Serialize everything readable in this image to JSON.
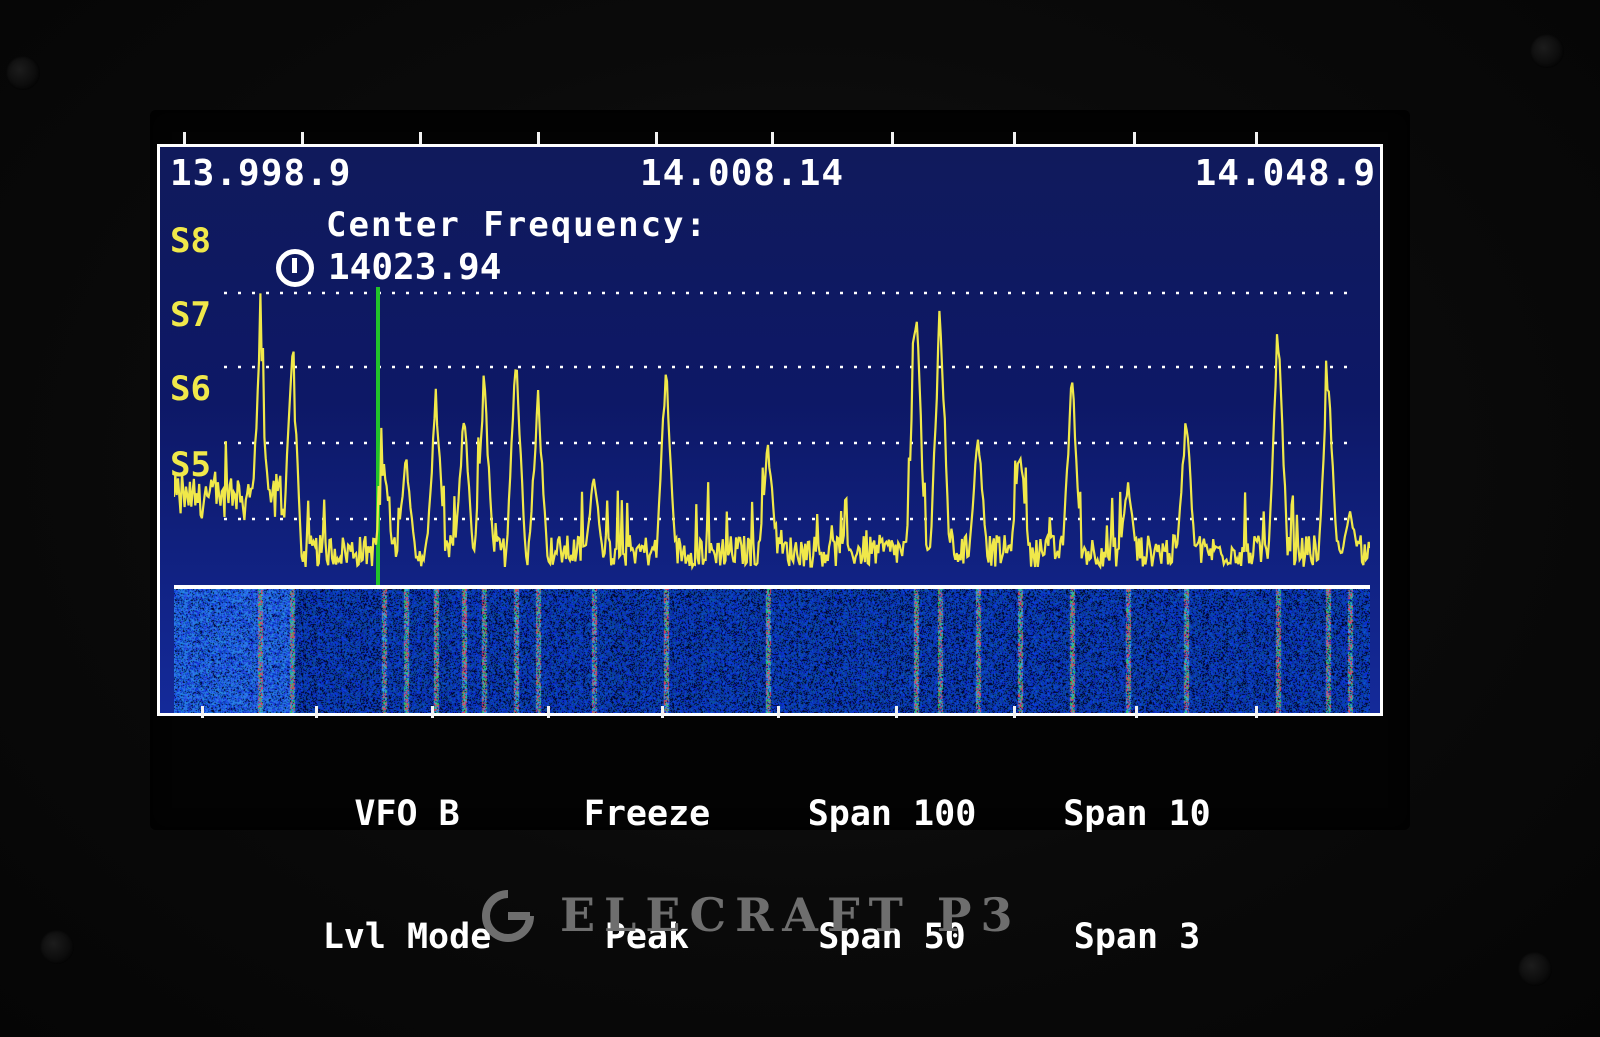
{
  "display": {
    "freq_left": "13.998.9",
    "freq_center": "14.008.14",
    "freq_right": "14.048.9",
    "center_freq_label": "Center Frequency:",
    "center_freq_value": "14023.94"
  },
  "s_meter": {
    "labels": [
      "S8",
      "S7",
      "S6",
      "S5"
    ]
  },
  "softkeys": [
    {
      "top": "VFO B",
      "bottom": "Lvl Mode"
    },
    {
      "top": "Freeze",
      "bottom": "Peak"
    },
    {
      "top": "Span 100",
      "bottom": "Span 50"
    },
    {
      "top": "Span 10",
      "bottom": "Span 3"
    }
  ],
  "brand": {
    "name": "ELECRAFT P3"
  },
  "colors": {
    "trace": "#f0e84a",
    "marker": "#22c22a",
    "panel": "#0d1866",
    "grid": "#ffffff"
  },
  "icons": {
    "cursor_icon": "power-icon",
    "brand_logo": "elecraft-logo"
  }
}
